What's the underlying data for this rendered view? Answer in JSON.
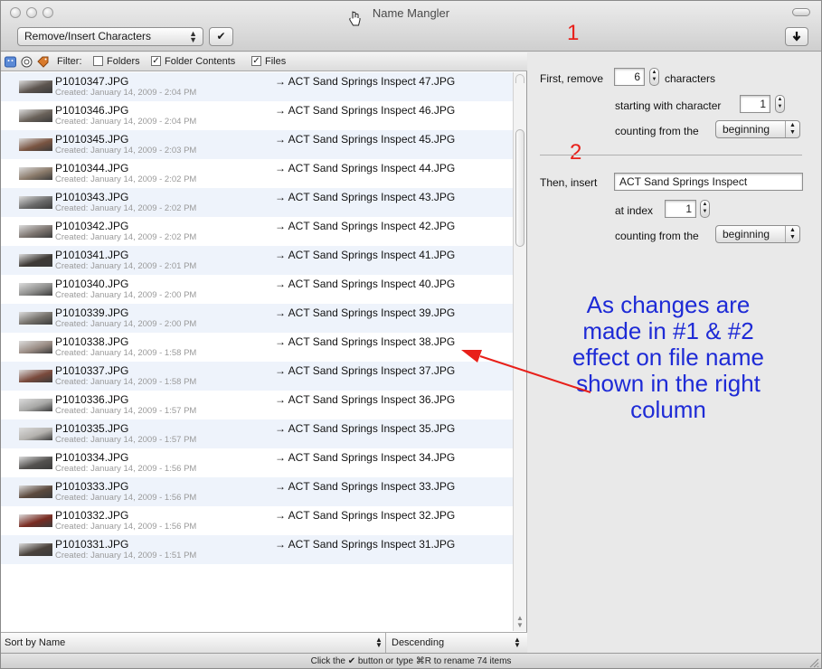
{
  "window": {
    "title": "Name Mangler"
  },
  "toolbar": {
    "mode_label": "Remove/Insert Characters",
    "apply_label": "✔"
  },
  "annotations": {
    "one": "1",
    "two": "2",
    "note": "As changes are made in #1 & #2 effect on file name shown in the right column"
  },
  "filter": {
    "label": "Filter:",
    "folders": "Folders",
    "folder_contents": "Folder Contents",
    "files": "Files",
    "folders_checked": false,
    "folder_contents_checked": true,
    "files_checked": true
  },
  "files": [
    {
      "name": "P1010347.JPG",
      "created": "Created: January 14, 2009 - 2:04 PM",
      "new_name": "→ ACT Sand Springs Inspect 47.JPG",
      "thumb": "#5d554f"
    },
    {
      "name": "P1010346.JPG",
      "created": "Created: January 14, 2009 - 2:04 PM",
      "new_name": "→ ACT Sand Springs Inspect 46.JPG",
      "thumb": "#6a625a"
    },
    {
      "name": "P1010345.JPG",
      "created": "Created: January 14, 2009 - 2:03 PM",
      "new_name": "→ ACT Sand Springs Inspect 45.JPG",
      "thumb": "#7a5542"
    },
    {
      "name": "P1010344.JPG",
      "created": "Created: January 14, 2009 - 2:02 PM",
      "new_name": "→ ACT Sand Springs Inspect 44.JPG",
      "thumb": "#8a7a6a"
    },
    {
      "name": "P1010343.JPG",
      "created": "Created: January 14, 2009 - 2:02 PM",
      "new_name": "→ ACT Sand Springs Inspect 43.JPG",
      "thumb": "#6b6b6b"
    },
    {
      "name": "P1010342.JPG",
      "created": "Created: January 14, 2009 - 2:02 PM",
      "new_name": "→ ACT Sand Springs Inspect 42.JPG",
      "thumb": "#7d7570"
    },
    {
      "name": "P1010341.JPG",
      "created": "Created: January 14, 2009 - 2:01 PM",
      "new_name": "→ ACT Sand Springs Inspect 41.JPG",
      "thumb": "#3e3a36"
    },
    {
      "name": "P1010340.JPG",
      "created": "Created: January 14, 2009 - 2:00 PM",
      "new_name": "→ ACT Sand Springs Inspect 40.JPG",
      "thumb": "#8e8e8c"
    },
    {
      "name": "P1010339.JPG",
      "created": "Created: January 14, 2009 - 2:00 PM",
      "new_name": "→ ACT Sand Springs Inspect 39.JPG",
      "thumb": "#74706a"
    },
    {
      "name": "P1010338.JPG",
      "created": "Created: January 14, 2009 - 1:58 PM",
      "new_name": "→ ACT Sand Springs Inspect 38.JPG",
      "thumb": "#9a8c84"
    },
    {
      "name": "P1010337.JPG",
      "created": "Created: January 14, 2009 - 1:58 PM",
      "new_name": "→ ACT Sand Springs Inspect 37.JPG",
      "thumb": "#7a4a3c"
    },
    {
      "name": "P1010336.JPG",
      "created": "Created: January 14, 2009 - 1:57 PM",
      "new_name": "→ ACT Sand Springs Inspect 36.JPG",
      "thumb": "#a8a8a6"
    },
    {
      "name": "P1010335.JPG",
      "created": "Created: January 14, 2009 - 1:57 PM",
      "new_name": "→ ACT Sand Springs Inspect 35.JPG",
      "thumb": "#b4b2ae"
    },
    {
      "name": "P1010334.JPG",
      "created": "Created: January 14, 2009 - 1:56 PM",
      "new_name": "→ ACT Sand Springs Inspect 34.JPG",
      "thumb": "#545250"
    },
    {
      "name": "P1010333.JPG",
      "created": "Created: January 14, 2009 - 1:56 PM",
      "new_name": "→ ACT Sand Springs Inspect 33.JPG",
      "thumb": "#5c4a3e"
    },
    {
      "name": "P1010332.JPG",
      "created": "Created: January 14, 2009 - 1:56 PM",
      "new_name": "→ ACT Sand Springs Inspect 32.JPG",
      "thumb": "#7a2c22"
    },
    {
      "name": "P1010331.JPG",
      "created": "Created: January 14, 2009 - 1:51 PM",
      "new_name": "→ ACT Sand Springs Inspect 31.JPG",
      "thumb": "#4a423c"
    }
  ],
  "sort": {
    "by": "Sort by Name",
    "order": "Descending"
  },
  "remove": {
    "first_label": "First, remove",
    "count": "6",
    "characters_label": "characters",
    "starting_label": "starting with character",
    "start": "1",
    "counting_label": "counting from the",
    "counting_value": "beginning"
  },
  "insert": {
    "then_label": "Then, insert",
    "text": "ACT Sand Springs Inspect",
    "index_label": "at index",
    "index": "1",
    "counting_label": "counting from the",
    "counting_value": "beginning"
  },
  "status": {
    "text": "Click the ✔ button or type ⌘R to rename 74 items"
  },
  "colors": {
    "annotation_red": "#e8201a",
    "note_blue": "#1e2bd6",
    "row_alt": "#eef3fb"
  }
}
